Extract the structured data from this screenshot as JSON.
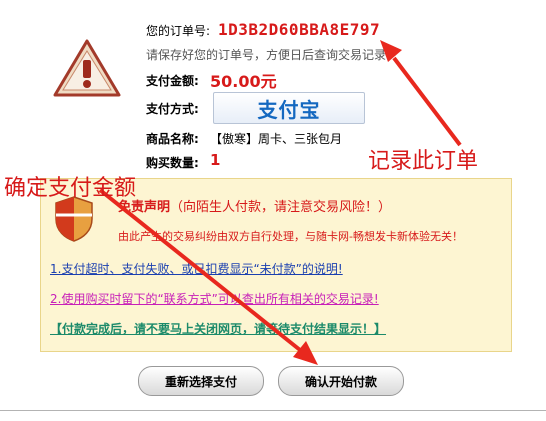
{
  "order": {
    "label": "您的订单号:",
    "number": "1D3B2D60BBA8E797",
    "hint": "请保存好您的订单号，方便日后查询交易记录"
  },
  "payment": {
    "amount_label": "支付金额:",
    "amount": "50.00元",
    "method_label": "支付方式:",
    "method_logo_text": "支付宝"
  },
  "product": {
    "label": "商品名称:",
    "name": "【傲寒】周卡、三张包月",
    "qty_label": "购买数量:",
    "qty": "1"
  },
  "notice": {
    "title": "免责声明",
    "title_sub": "（向陌生人付款，请注意交易风险！）",
    "subtitle": "由此产生的交易纠纷由双方自行处理，与随卡网-畅想发卡新体验无关！",
    "link1": "1.支付超时、支付失败、或已扣费显示“未付款”的说明!",
    "link2": "2.使用购买时留下的“联系方式”可以查出所有相关的交易记录!",
    "link3": "【付款完成后，请不要马上关闭网页，请等待支付结果显示！】"
  },
  "buttons": {
    "reselect": "重新选择支付",
    "confirm": "确认开始付款"
  },
  "annotations": {
    "record_order": "记录此订单",
    "confirm_amount": "确定支付金额"
  },
  "colors": {
    "accent_red": "#d71a1a",
    "notice_bg": "#fdf5d2"
  },
  "icons": [
    "warning-icon",
    "shield-icon",
    "alipay-logo"
  ]
}
